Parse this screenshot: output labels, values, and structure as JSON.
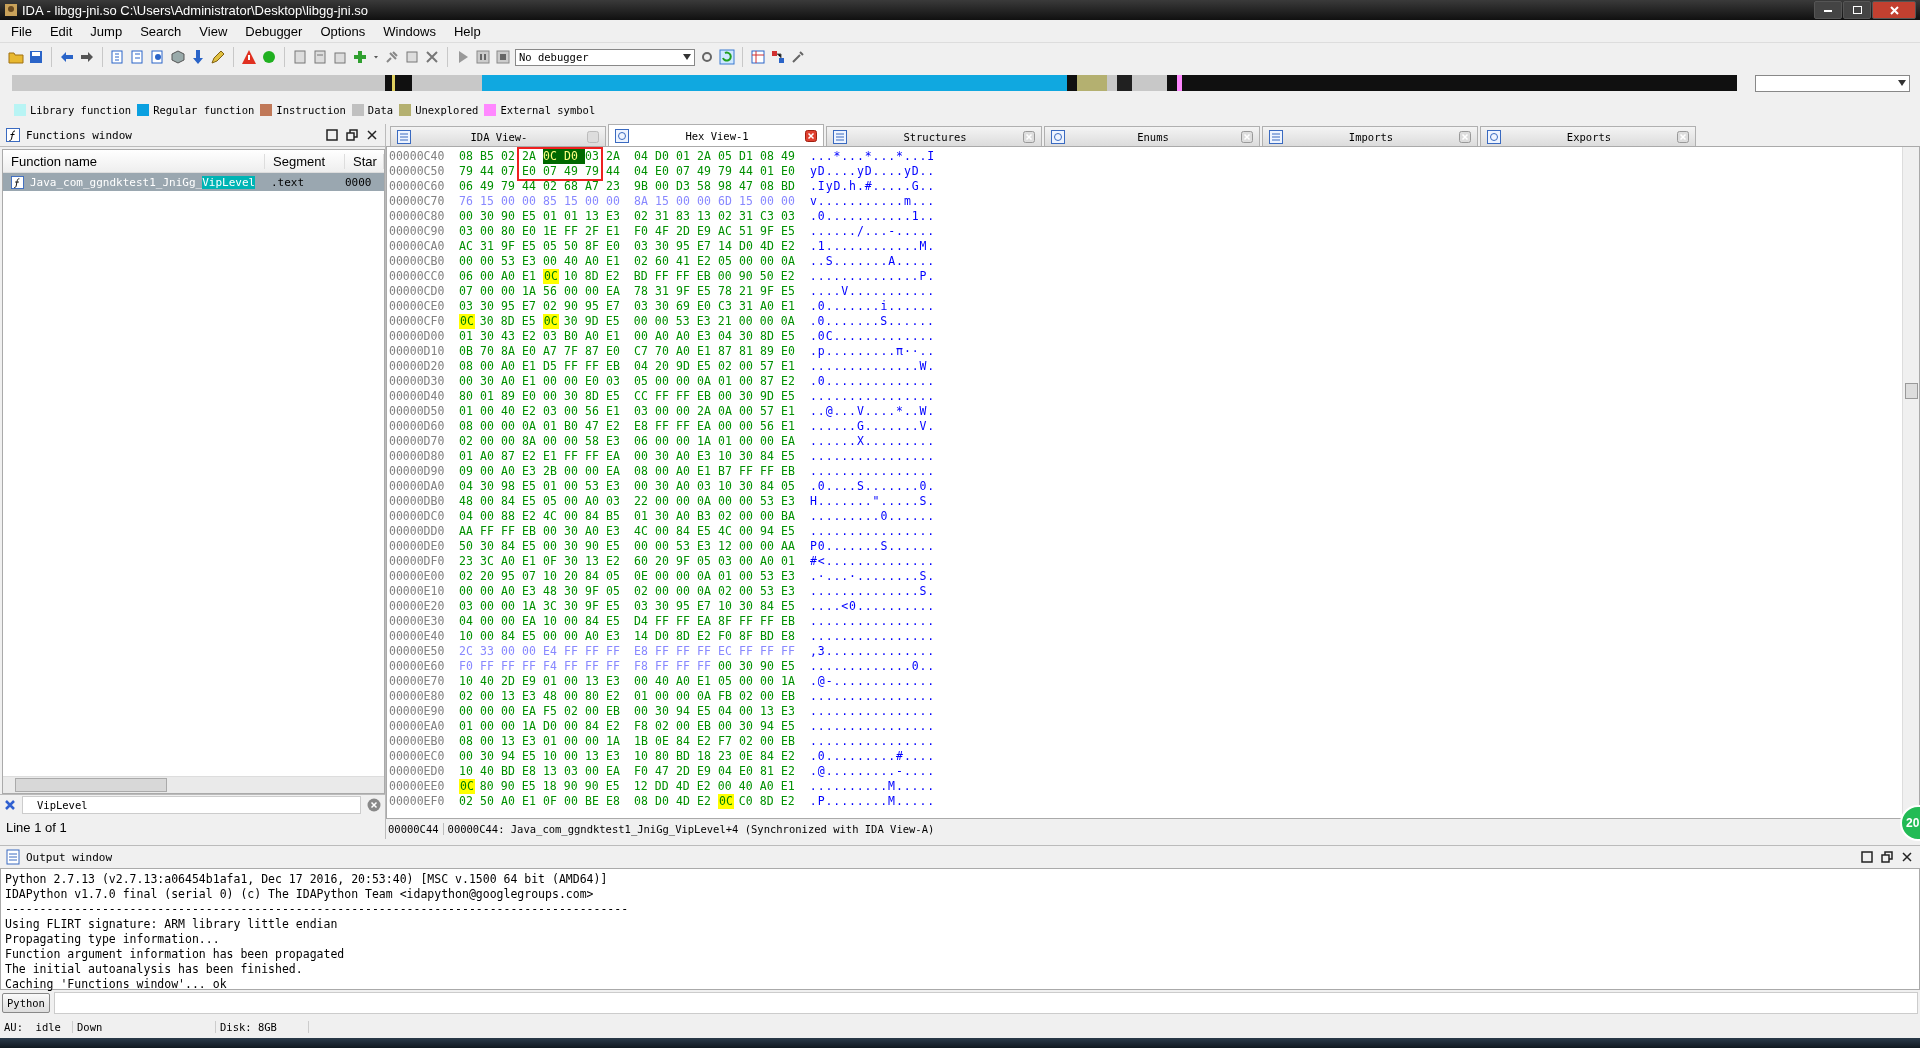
{
  "window": {
    "title": "IDA - libgg-jni.so C:\\Users\\Administrator\\Desktop\\libgg-jni.so"
  },
  "menu": [
    "File",
    "Edit",
    "Jump",
    "Search",
    "View",
    "Debugger",
    "Options",
    "Windows",
    "Help"
  ],
  "toolbar": {
    "debugger": "No debugger"
  },
  "legend": [
    {
      "label": "Library function",
      "color": "#b8f4f4"
    },
    {
      "label": "Regular function",
      "color": "#0aa0e0"
    },
    {
      "label": "Instruction",
      "color": "#c07858"
    },
    {
      "label": "Data",
      "color": "#c0c0c0"
    },
    {
      "label": "Unexplored",
      "color": "#b4b070"
    },
    {
      "label": "External symbol",
      "color": "#ff88ff"
    }
  ],
  "functions_window": {
    "title": "Functions window",
    "columns": [
      "Function name",
      "Segment",
      "Star"
    ],
    "rows": [
      {
        "name": "Java_com_ggndktest1_JniGg_",
        "match": "VipLevel",
        "segment": ".text",
        "start": "0000",
        "selected": true
      }
    ],
    "filter": "VipLevel",
    "status": "Line 1 of 1"
  },
  "tabs": [
    {
      "label": "IDA View-",
      "selected": false,
      "closable": false
    },
    {
      "label": "Hex View-1",
      "selected": true,
      "closable": true
    },
    {
      "label": "Structures",
      "selected": false,
      "closable": true
    },
    {
      "label": "Enums",
      "selected": false,
      "closable": true
    },
    {
      "label": "Imports",
      "selected": false,
      "closable": true
    },
    {
      "label": "Exports",
      "selected": false,
      "closable": true
    }
  ],
  "hex": {
    "rows": [
      {
        "address": "00000C40",
        "kind": "code",
        "bytes": [
          "08",
          "B5",
          "02",
          "2A",
          {
            "hex": "0C",
            "kind": "selected"
          },
          {
            "hex": "D0",
            "kind": "selected"
          },
          "03",
          "2A",
          "04",
          "D0",
          "01",
          "2A",
          "05",
          "D1",
          "08",
          "49"
        ],
        "ascii": "...*...*...*...I"
      },
      {
        "address": "00000C50",
        "kind": "code",
        "bytes": [
          "79",
          "44",
          "07",
          "E0",
          "07",
          "49",
          "79",
          "44",
          "04",
          "E0",
          "07",
          "49",
          "79",
          "44",
          "01",
          "E0"
        ],
        "ascii": "yD....yD....yD.."
      },
      {
        "address": "00000C60",
        "kind": "code",
        "bytes": [
          "06",
          "49",
          "79",
          "44",
          "02",
          "68",
          "A7",
          "23",
          "9B",
          "00",
          "D3",
          "58",
          "98",
          "47",
          "08",
          "BD"
        ],
        "ascii": ".IyD.h.#.....G.."
      },
      {
        "address": "00000C70",
        "kind": "data",
        "bytes": [
          "76",
          "15",
          "00",
          "00",
          "85",
          "15",
          "00",
          "00",
          "8A",
          "15",
          "00",
          "00",
          "6D",
          "15",
          "00",
          "00"
        ],
        "ascii": "v...........m..."
      },
      {
        "address": "00000C80",
        "kind": "code",
        "bytes": [
          "00",
          "30",
          "90",
          "E5",
          "01",
          "01",
          "13",
          "E3",
          "02",
          "31",
          "83",
          "13",
          "02",
          "31",
          "C3",
          "03"
        ],
        "ascii": ".0...........1.."
      },
      {
        "address": "00000C90",
        "kind": "code",
        "bytes": [
          "03",
          "00",
          "80",
          "E0",
          "1E",
          "FF",
          "2F",
          "E1",
          "F0",
          "4F",
          "2D",
          "E9",
          "AC",
          "51",
          "9F",
          "E5"
        ],
        "ascii": "....../...-....."
      },
      {
        "address": "00000CA0",
        "kind": "code",
        "bytes": [
          "AC",
          "31",
          "9F",
          "E5",
          "05",
          "50",
          "8F",
          "E0",
          "03",
          "30",
          "95",
          "E7",
          "14",
          "D0",
          "4D",
          "E2"
        ],
        "ascii": ".1............M."
      },
      {
        "address": "00000CB0",
        "kind": "code",
        "bytes": [
          "00",
          "00",
          "53",
          "E3",
          "00",
          "40",
          "A0",
          "E1",
          "02",
          "60",
          "41",
          "E2",
          "05",
          "00",
          "00",
          "0A"
        ],
        "ascii": "..S.......A....."
      },
      {
        "address": "00000CC0",
        "kind": "code",
        "bytes": [
          "06",
          "00",
          "A0",
          "E1",
          {
            "hex": "0C",
            "kind": "match"
          },
          "10",
          "8D",
          "E2",
          "BD",
          "FF",
          "FF",
          "EB",
          "00",
          "90",
          "50",
          "E2"
        ],
        "ascii": "..............P."
      },
      {
        "address": "00000CD0",
        "kind": "code",
        "bytes": [
          "07",
          "00",
          "00",
          "1A",
          "56",
          "00",
          "00",
          "EA",
          "78",
          "31",
          "9F",
          "E5",
          "78",
          "21",
          "9F",
          "E5"
        ],
        "ascii": "....V..........."
      },
      {
        "address": "00000CE0",
        "kind": "code",
        "bytes": [
          "03",
          "30",
          "95",
          "E7",
          "02",
          "90",
          "95",
          "E7",
          "03",
          "30",
          "69",
          "E0",
          "C3",
          "31",
          "A0",
          "E1"
        ],
        "ascii": ".0.......i......"
      },
      {
        "address": "00000CF0",
        "kind": "code",
        "bytes": [
          {
            "hex": "0C",
            "kind": "match"
          },
          "30",
          "8D",
          "E5",
          {
            "hex": "0C",
            "kind": "match"
          },
          "30",
          "9D",
          "E5",
          "00",
          "00",
          "53",
          "E3",
          "21",
          "00",
          "00",
          "0A"
        ],
        "ascii": ".0.......S......"
      },
      {
        "address": "00000D00",
        "kind": "code",
        "bytes": [
          "01",
          "30",
          "43",
          "E2",
          "03",
          "B0",
          "A0",
          "E1",
          "00",
          "A0",
          "A0",
          "E3",
          "04",
          "30",
          "8D",
          "E5"
        ],
        "ascii": ".0C............."
      },
      {
        "address": "00000D10",
        "kind": "code",
        "bytes": [
          "0B",
          "70",
          "8A",
          "E0",
          "A7",
          "7F",
          "87",
          "E0",
          "C7",
          "70",
          "A0",
          "E1",
          "87",
          "81",
          "89",
          "E0"
        ],
        "ascii": ".p.........π··.."
      },
      {
        "address": "00000D20",
        "kind": "code",
        "bytes": [
          "08",
          "00",
          "A0",
          "E1",
          "D5",
          "FF",
          "FF",
          "EB",
          "04",
          "20",
          "9D",
          "E5",
          "02",
          "00",
          "57",
          "E1"
        ],
        "ascii": "..............W."
      },
      {
        "address": "00000D30",
        "kind": "code",
        "bytes": [
          "00",
          "30",
          "A0",
          "E1",
          "00",
          "00",
          "E0",
          "03",
          "05",
          "00",
          "00",
          "0A",
          "01",
          "00",
          "87",
          "E2"
        ],
        "ascii": ".0.............."
      },
      {
        "address": "00000D40",
        "kind": "code",
        "bytes": [
          "80",
          "01",
          "89",
          "E0",
          "00",
          "30",
          "8D",
          "E5",
          "CC",
          "FF",
          "FF",
          "EB",
          "00",
          "30",
          "9D",
          "E5"
        ],
        "ascii": "................"
      },
      {
        "address": "00000D50",
        "kind": "code",
        "bytes": [
          "01",
          "00",
          "40",
          "E2",
          "03",
          "00",
          "56",
          "E1",
          "03",
          "00",
          "00",
          "2A",
          "0A",
          "00",
          "57",
          "E1"
        ],
        "ascii": "..@...V....*..W."
      },
      {
        "address": "00000D60",
        "kind": "code",
        "bytes": [
          "08",
          "00",
          "00",
          "0A",
          "01",
          "B0",
          "47",
          "E2",
          "E8",
          "FF",
          "FF",
          "EA",
          "00",
          "00",
          "56",
          "E1"
        ],
        "ascii": "......G.......V."
      },
      {
        "address": "00000D70",
        "kind": "code",
        "bytes": [
          "02",
          "00",
          "00",
          "8A",
          "00",
          "00",
          "58",
          "E3",
          "06",
          "00",
          "00",
          "1A",
          "01",
          "00",
          "00",
          "EA"
        ],
        "ascii": "......X........."
      },
      {
        "address": "00000D80",
        "kind": "code",
        "bytes": [
          "01",
          "A0",
          "87",
          "E2",
          "E1",
          "FF",
          "FF",
          "EA",
          "00",
          "30",
          "A0",
          "E3",
          "10",
          "30",
          "84",
          "E5"
        ],
        "ascii": "................"
      },
      {
        "address": "00000D90",
        "kind": "code",
        "bytes": [
          "09",
          "00",
          "A0",
          "E3",
          "2B",
          "00",
          "00",
          "EA",
          "08",
          "00",
          "A0",
          "E1",
          "B7",
          "FF",
          "FF",
          "EB"
        ],
        "ascii": "................"
      },
      {
        "address": "00000DA0",
        "kind": "code",
        "bytes": [
          "04",
          "30",
          "98",
          "E5",
          "01",
          "00",
          "53",
          "E3",
          "00",
          "30",
          "A0",
          "03",
          "10",
          "30",
          "84",
          "05"
        ],
        "ascii": ".0....S.......0."
      },
      {
        "address": "00000DB0",
        "kind": "code",
        "bytes": [
          "48",
          "00",
          "84",
          "E5",
          "05",
          "00",
          "A0",
          "03",
          "22",
          "00",
          "00",
          "0A",
          "00",
          "00",
          "53",
          "E3"
        ],
        "ascii": "H.......\".....S."
      },
      {
        "address": "00000DC0",
        "kind": "code",
        "bytes": [
          "04",
          "00",
          "88",
          "E2",
          "4C",
          "00",
          "84",
          "B5",
          "01",
          "30",
          "A0",
          "B3",
          "02",
          "00",
          "00",
          "BA"
        ],
        "ascii": ".........0......"
      },
      {
        "address": "00000DD0",
        "kind": "code",
        "bytes": [
          "AA",
          "FF",
          "FF",
          "EB",
          "00",
          "30",
          "A0",
          "E3",
          "4C",
          "00",
          "84",
          "E5",
          "4C",
          "00",
          "94",
          "E5"
        ],
        "ascii": "................"
      },
      {
        "address": "00000DE0",
        "kind": "code",
        "bytes": [
          "50",
          "30",
          "84",
          "E5",
          "00",
          "30",
          "90",
          "E5",
          "00",
          "00",
          "53",
          "E3",
          "12",
          "00",
          "00",
          "AA"
        ],
        "ascii": "P0.......S......"
      },
      {
        "address": "00000DF0",
        "kind": "code",
        "bytes": [
          "23",
          "3C",
          "A0",
          "E1",
          "0F",
          "30",
          "13",
          "E2",
          "60",
          "20",
          "9F",
          "05",
          "03",
          "00",
          "A0",
          "01"
        ],
        "ascii": "#<.............."
      },
      {
        "address": "00000E00",
        "kind": "code",
        "bytes": [
          "02",
          "20",
          "95",
          "07",
          "10",
          "20",
          "84",
          "05",
          "0E",
          "00",
          "00",
          "0A",
          "01",
          "00",
          "53",
          "E3"
        ],
        "ascii": ".·...·........S."
      },
      {
        "address": "00000E10",
        "kind": "code",
        "bytes": [
          "00",
          "00",
          "A0",
          "E3",
          "48",
          "30",
          "9F",
          "05",
          "02",
          "00",
          "00",
          "0A",
          "02",
          "00",
          "53",
          "E3"
        ],
        "ascii": "..............S."
      },
      {
        "address": "00000E20",
        "kind": "code",
        "bytes": [
          "03",
          "00",
          "00",
          "1A",
          "3C",
          "30",
          "9F",
          "E5",
          "03",
          "30",
          "95",
          "E7",
          "10",
          "30",
          "84",
          "E5"
        ],
        "ascii": "....<0.........."
      },
      {
        "address": "00000E30",
        "kind": "code",
        "bytes": [
          "04",
          "00",
          "00",
          "EA",
          "10",
          "00",
          "84",
          "E5",
          "D4",
          "FF",
          "FF",
          "EA",
          "8F",
          "FF",
          "FF",
          "EB"
        ],
        "ascii": "................"
      },
      {
        "address": "00000E40",
        "kind": "code",
        "bytes": [
          "10",
          "00",
          "84",
          "E5",
          "00",
          "00",
          "A0",
          "E3",
          "14",
          "D0",
          "8D",
          "E2",
          "F0",
          "8F",
          "BD",
          "E8"
        ],
        "ascii": "................"
      },
      {
        "address": "00000E50",
        "kind": "data",
        "bytes": [
          "2C",
          "33",
          "00",
          "00",
          "E4",
          "FF",
          "FF",
          "FF",
          "E8",
          "FF",
          "FF",
          "FF",
          "EC",
          "FF",
          "FF",
          "FF"
        ],
        "ascii": ",3.............."
      },
      {
        "address": "00000E60",
        "kind": "data",
        "bytes": [
          "F0",
          "FF",
          "FF",
          "FF",
          "F4",
          "FF",
          "FF",
          "FF",
          "F8",
          "FF",
          "FF",
          "FF",
          {
            "hex": "00",
            "kind": "code"
          },
          {
            "hex": "30",
            "kind": "code"
          },
          {
            "hex": "90",
            "kind": "code"
          },
          {
            "hex": "E5",
            "kind": "code"
          }
        ],
        "ascii": ".............0.."
      },
      {
        "address": "00000E70",
        "kind": "code",
        "bytes": [
          "10",
          "40",
          "2D",
          "E9",
          "01",
          "00",
          "13",
          "E3",
          "00",
          "40",
          "A0",
          "E1",
          "05",
          "00",
          "00",
          "1A"
        ],
        "ascii": ".@-............."
      },
      {
        "address": "00000E80",
        "kind": "code",
        "bytes": [
          "02",
          "00",
          "13",
          "E3",
          "48",
          "00",
          "80",
          "E2",
          "01",
          "00",
          "00",
          "0A",
          "FB",
          "02",
          "00",
          "EB"
        ],
        "ascii": "................"
      },
      {
        "address": "00000E90",
        "kind": "code",
        "bytes": [
          "00",
          "00",
          "00",
          "EA",
          "F5",
          "02",
          "00",
          "EB",
          "00",
          "30",
          "94",
          "E5",
          "04",
          "00",
          "13",
          "E3"
        ],
        "ascii": "................"
      },
      {
        "address": "00000EA0",
        "kind": "code",
        "bytes": [
          "01",
          "00",
          "00",
          "1A",
          "D0",
          "00",
          "84",
          "E2",
          "F8",
          "02",
          "00",
          "EB",
          "00",
          "30",
          "94",
          "E5"
        ],
        "ascii": "................"
      },
      {
        "address": "00000EB0",
        "kind": "code",
        "bytes": [
          "08",
          "00",
          "13",
          "E3",
          "01",
          "00",
          "00",
          "1A",
          "1B",
          "0E",
          "84",
          "E2",
          "F7",
          "02",
          "00",
          "EB"
        ],
        "ascii": "................"
      },
      {
        "address": "00000EC0",
        "kind": "code",
        "bytes": [
          "00",
          "30",
          "94",
          "E5",
          "10",
          "00",
          "13",
          "E3",
          "10",
          "80",
          "BD",
          "18",
          "23",
          "0E",
          "84",
          "E2"
        ],
        "ascii": ".0.........#...."
      },
      {
        "address": "00000ED0",
        "kind": "code",
        "bytes": [
          "10",
          "40",
          "BD",
          "E8",
          "13",
          "03",
          "00",
          "EA",
          "F0",
          "47",
          "2D",
          "E9",
          "04",
          "E0",
          "81",
          "E2"
        ],
        "ascii": ".@.........-...."
      },
      {
        "address": "00000EE0",
        "kind": "code",
        "bytes": [
          {
            "hex": "0C",
            "kind": "match"
          },
          "80",
          "90",
          "E5",
          "18",
          "90",
          "90",
          "E5",
          "12",
          "DD",
          "4D",
          "E2",
          "00",
          "40",
          "A0",
          "E1"
        ],
        "ascii": "..........M....."
      },
      {
        "address": "00000EF0",
        "kind": "code",
        "bytes": [
          "02",
          "50",
          "A0",
          "E1",
          "0F",
          "00",
          "BE",
          "E8",
          "08",
          "D0",
          "4D",
          "E2",
          {
            "hex": "0C",
            "kind": "match"
          },
          "C0",
          "8D",
          "E2"
        ],
        "ascii": ".P........M....."
      }
    ],
    "status_offset": "00000C44",
    "status_text": "00000C44: Java_com_ggndktest1_JniGg_VipLevel+4 (Synchronized with IDA View-A)"
  },
  "output_window": {
    "title": "Output window",
    "lines": [
      "Python 2.7.13 (v2.7.13:a06454b1afa1, Dec 17 2016, 20:53:40) [MSC v.1500 64 bit (AMD64)]",
      "IDAPython v1.7.0 final (serial 0) (c) The IDAPython Team <idapython@googlegroups.com>",
      "------------------------------------------------------------------------------------------",
      "Using FLIRT signature: ARM library little endian",
      "Propagating type information...",
      "Function argument information has been propagated",
      "The initial autoanalysis has been finished.",
      "Caching 'Functions window'... ok"
    ],
    "language": "Python"
  },
  "status_bar": [
    "AU:  idle",
    "Down",
    "Disk: 8GB"
  ],
  "badge": "20"
}
